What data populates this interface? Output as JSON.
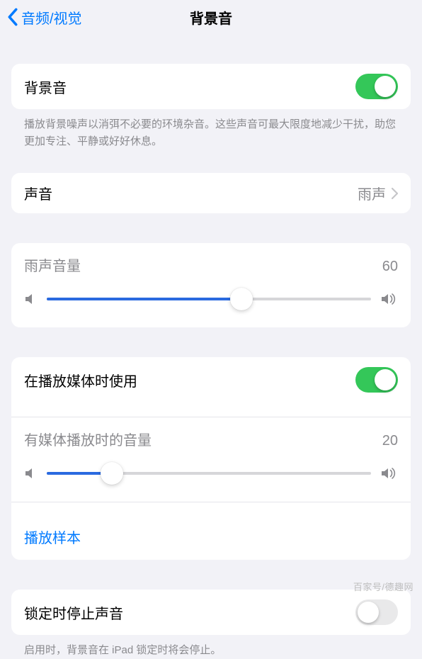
{
  "nav": {
    "back_label": "音频/视觉",
    "title": "背景音"
  },
  "background_sound": {
    "label": "背景音",
    "enabled": true,
    "description": "播放背景噪声以消弭不必要的环境杂音。这些声音可最大限度地减少干扰，助您更加专注、平静或好好休息。"
  },
  "sound_row": {
    "label": "声音",
    "value": "雨声"
  },
  "rain_volume": {
    "label": "雨声音量",
    "value": 60
  },
  "media": {
    "use_with_media_label": "在播放媒体时使用",
    "use_with_media_enabled": true,
    "media_volume_label": "有媒体播放时的音量",
    "media_volume_value": 20,
    "play_sample_label": "播放样本"
  },
  "lock": {
    "label": "锁定时停止声音",
    "enabled": false,
    "description": "启用时，背景音在 iPad 锁定时将会停止。"
  },
  "watermark": "百家号/德趣网"
}
